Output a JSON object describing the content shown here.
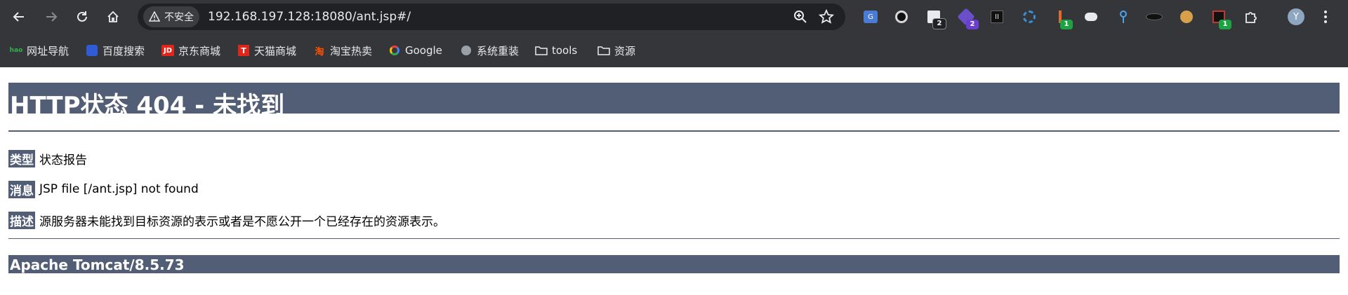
{
  "browser": {
    "security_label": "不安全",
    "url": "192.168.197.128:18080/ant.jsp#/",
    "profile_initial": "Y",
    "extension_badges": {
      "ext_3": "2",
      "ext_4": "2",
      "ext_8": "1",
      "ext_14": "1"
    }
  },
  "bookmarks": [
    {
      "label": "网址导航",
      "icon": "hao-icon"
    },
    {
      "label": "百度搜索",
      "icon": "baidu-icon"
    },
    {
      "label": "京东商城",
      "icon": "jd-icon"
    },
    {
      "label": "天猫商城",
      "icon": "tmall-icon"
    },
    {
      "label": "淘宝热卖",
      "icon": "taobao-icon"
    },
    {
      "label": "Google",
      "icon": "google-icon"
    },
    {
      "label": "系统重装",
      "icon": "globe-icon"
    },
    {
      "label": "tools",
      "icon": "folder-icon"
    },
    {
      "label": "资源",
      "icon": "folder-icon"
    }
  ],
  "page": {
    "title": "HTTP状态 404 - 未找到",
    "rows": [
      {
        "label": "类型",
        "value": "状态报告"
      },
      {
        "label": "消息",
        "value": "JSP file [/ant.jsp] not found"
      },
      {
        "label": "描述",
        "value": "源服务器未能找到目标资源的表示或者是不愿公开一个已经存在的资源表示。"
      }
    ],
    "footer": "Apache Tomcat/8.5.73"
  },
  "colors": {
    "tomcat_bar": "#525d76",
    "browser_chrome": "#35363a",
    "omnibox": "#202124"
  }
}
